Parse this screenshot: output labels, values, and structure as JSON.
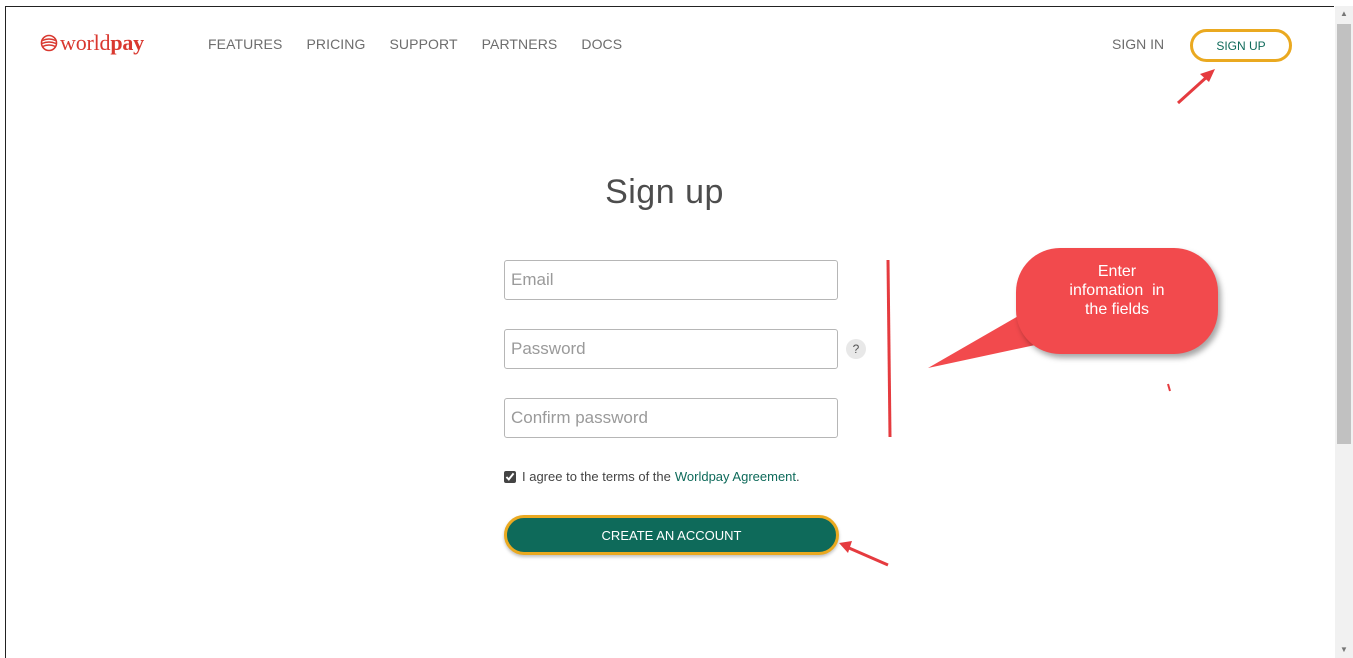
{
  "header": {
    "logo": {
      "word_1": "world",
      "word_2": "pay"
    },
    "nav": [
      "FEATURES",
      "PRICING",
      "SUPPORT",
      "PARTNERS",
      "DOCS"
    ],
    "sign_in": "SIGN IN",
    "sign_up": "SIGN UP"
  },
  "form": {
    "title": "Sign up",
    "email_placeholder": "Email",
    "password_placeholder": "Password",
    "confirm_placeholder": "Confirm password",
    "help_glyph": "?",
    "agree_text": "I agree to the terms of the",
    "agree_link": "Worldpay Agreement",
    "agree_suffix": ".",
    "agree_checked": true,
    "create_button": "CREATE AN ACCOUNT"
  },
  "annotation": {
    "callout_lines": [
      "Enter",
      "infomation  in",
      "the fields"
    ],
    "callout_color": "#f24a4d",
    "highlight_color": "#eaa920",
    "arrow_color": "#e53b3f"
  },
  "colors": {
    "brand": "#d9382f",
    "accent": "#0e6a5a"
  }
}
